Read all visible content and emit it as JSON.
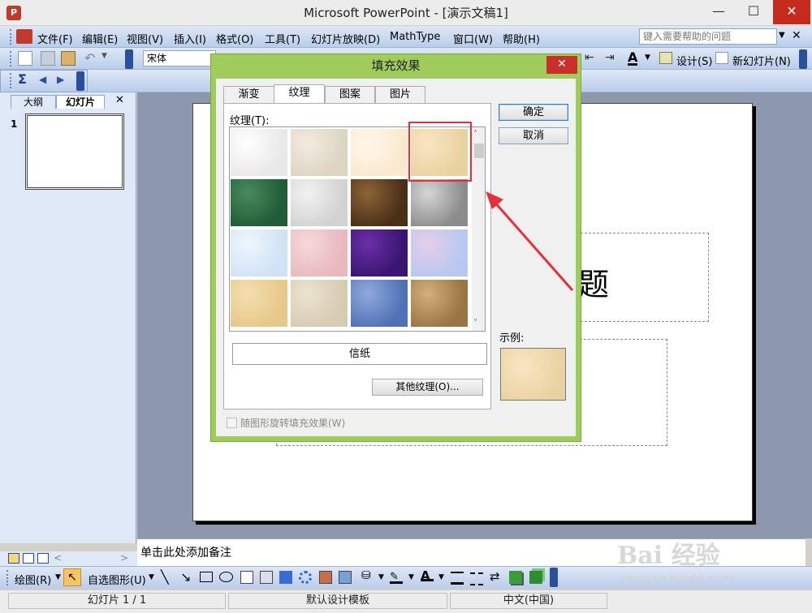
{
  "window": {
    "title": "Microsoft PowerPoint - [演示文稿1]",
    "minimize": "—",
    "maximize": "☐",
    "close": "✕"
  },
  "menubar": {
    "items": [
      "文件(F)",
      "编辑(E)",
      "视图(V)",
      "插入(I)",
      "格式(O)",
      "工具(T)",
      "幻灯片放映(D)",
      "MathType",
      "窗口(W)",
      "帮助(H)"
    ],
    "help_placeholder": "键入需要帮助的问题",
    "close": "✕"
  },
  "toolbar": {
    "font": "宋体",
    "design_label": "设计(S)",
    "new_slide_label": "新幻灯片(N)"
  },
  "left_panel": {
    "tab_outline": "大纲",
    "tab_slides": "幻灯片",
    "close": "✕",
    "slide_number": "1"
  },
  "slide": {
    "title_partial": "题"
  },
  "notes": {
    "placeholder": "单击此处添加备注"
  },
  "drawbar": {
    "draw_label": "绘图(R)",
    "autoshape_label": "自选图形(U)"
  },
  "statusbar": {
    "slide_info": "幻灯片 1 / 1",
    "template": "默认设计模板",
    "language": "中文(中国)"
  },
  "dialog": {
    "title": "填充效果",
    "close": "✕",
    "tabs": [
      "渐变",
      "纹理",
      "图案",
      "图片"
    ],
    "active_tab": "纹理",
    "texture_label": "纹理(T):",
    "selected_texture": "信纸",
    "other_texture_button": "其他纹理(O)...",
    "ok": "确定",
    "cancel": "取消",
    "sample_label": "示例:",
    "rotate_checkbox": "随图形旋转填充效果(W)",
    "textures": [
      [
        "#e8e8e8",
        "#ffffff"
      ],
      [
        "#ddd4c2",
        "#f2ece0"
      ],
      [
        "#fbe9cf",
        "#fff7ea"
      ],
      [
        "#ead1a0",
        "#f8e6c3"
      ],
      [
        "#1f5c37",
        "#4a8a5e"
      ],
      [
        "#d2d2d2",
        "#f2f2f2"
      ],
      [
        "#4a2e16",
        "#8c6438"
      ],
      [
        "#8c8c8c",
        "#d6d6d6"
      ],
      [
        "#cfe3f5",
        "#eef6fd"
      ],
      [
        "#e8b9be",
        "#f5d8db"
      ],
      [
        "#3a1472",
        "#6a2fa8"
      ],
      [
        "#b8c8f2",
        "#e6cde9"
      ],
      [
        "#e6c889",
        "#f4dfb0"
      ],
      [
        "#d6cbb3",
        "#ece3cf"
      ],
      [
        "#4f72b6",
        "#8fa9dc"
      ],
      [
        "#9a7443",
        "#d3b17a"
      ]
    ],
    "sample_colors": [
      "#ead1a0",
      "#f8e6c3"
    ]
  },
  "watermark": {
    "logo": "Bai 经验",
    "url": "jingyan.baidu.com"
  }
}
